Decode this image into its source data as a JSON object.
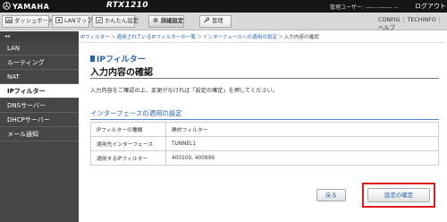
{
  "header": {
    "brand": "YAMAHA",
    "model": "RTX1210",
    "user_info": "管理ユーザー: ----- -------- --",
    "logout_label": "ログアウト"
  },
  "tabs": [
    {
      "label": "ダッシュボード",
      "icon": "dashboard-icon"
    },
    {
      "label": "LANマップ",
      "icon": "lan-map-icon"
    },
    {
      "label": "かんたん設定",
      "icon": "easy-setup-icon"
    },
    {
      "label": "詳細設定",
      "icon": "gear-icon",
      "active": true
    },
    {
      "label": "管理",
      "icon": "wrench-icon"
    }
  ],
  "top_links": {
    "config": "CONFIG",
    "techinfo": "TECHINFO",
    "help": "ヘルプ"
  },
  "sidebar": {
    "collapse_label": "◂◂",
    "items": [
      {
        "label": "LAN"
      },
      {
        "label": "ルーティング"
      },
      {
        "label": "NAT"
      },
      {
        "label": "IPフィルター",
        "active": true
      },
      {
        "label": "DNSサーバー"
      },
      {
        "label": "DHCPサーバー"
      },
      {
        "label": "メール通知"
      }
    ]
  },
  "breadcrumb": {
    "items": [
      "IPフィルター",
      "適用されているIPフィルターの一覧",
      "インターフェースへの適用の設定"
    ],
    "current": "入力内容の確認",
    "separator": "＞"
  },
  "page": {
    "subtitle": "IPフィルター",
    "title": "入力内容の確認",
    "instruction": "入力内容をご確認の上、変更がなければ「設定の確定」を押してください。"
  },
  "section": {
    "title": "インターフェースの適用の設定",
    "rows": [
      {
        "label": "IPフィルターの種類",
        "value": "静的フィルター"
      },
      {
        "label": "適用先インターフェース",
        "value": "TUNNEL1"
      },
      {
        "label": "適用するIPフィルター",
        "value": "400100, 400999"
      }
    ]
  },
  "buttons": {
    "back": "戻る",
    "confirm": "設定の確定"
  },
  "colors": {
    "accent": "#2a63a8",
    "highlight": "#e0191f",
    "sidebar": "#464646",
    "topbar": "#151515"
  }
}
